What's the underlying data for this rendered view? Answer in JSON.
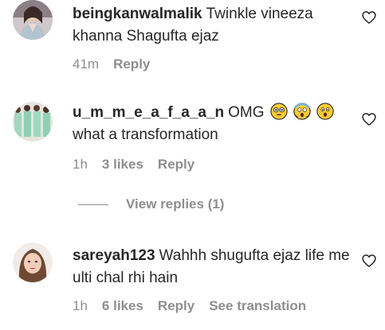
{
  "comments": [
    {
      "username": "beingkanwalmalik",
      "text": "Twinkle vineeza khanna Shagufta ejaz",
      "time": "41m",
      "likes": "",
      "reply": "Reply",
      "see_translation": ""
    },
    {
      "username": "u_m_m_e_a_f_a_a_n",
      "text": "OMG",
      "text_line2": "what a transformation",
      "emojis": [
        "flushed-face-icon",
        "screaming-face-icon",
        "astonished-face-icon"
      ],
      "time": "1h",
      "likes": "3 likes",
      "reply": "Reply",
      "see_translation": ""
    },
    {
      "username": "sareyah123",
      "text": "Wahhh shugufta ejaz life me ulti chal rhi hain",
      "time": "1h",
      "likes": "6 likes",
      "reply": "Reply",
      "see_translation": "See translation"
    }
  ],
  "view_replies": "View replies (1)",
  "colors": {
    "text": "#262626",
    "secondary": "#8e8e8e",
    "emoji_yellow": "#ffcc33"
  }
}
